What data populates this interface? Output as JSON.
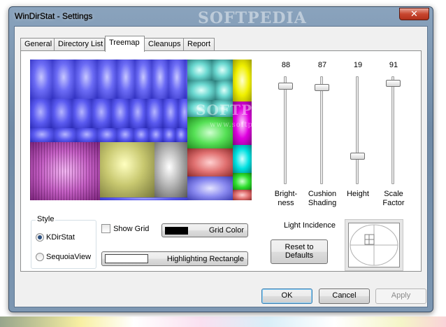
{
  "window": {
    "title": "WinDirStat - Settings",
    "close_glyph": "✕"
  },
  "watermarks": {
    "title": "SOFTPEDIA",
    "center": "SOFTPEDIA",
    "url": "www.softpedia.com"
  },
  "tabs": [
    {
      "label": "General",
      "active": false
    },
    {
      "label": "Directory List",
      "active": false
    },
    {
      "label": "Treemap",
      "active": true
    },
    {
      "label": "Cleanups",
      "active": false
    },
    {
      "label": "Report",
      "active": false
    }
  ],
  "sliders": [
    {
      "value": "88",
      "label_line1": "Bright-",
      "label_line2": "ness",
      "level_percent": 88
    },
    {
      "value": "87",
      "label_line1": "Cushion",
      "label_line2": "Shading",
      "level_percent": 87
    },
    {
      "value": "19",
      "label_line1": "Height",
      "label_line2": "",
      "level_percent": 19
    },
    {
      "value": "91",
      "label_line1": "Scale",
      "label_line2": "Factor",
      "level_percent": 91
    }
  ],
  "style_group": {
    "title": "Style",
    "options": [
      {
        "label": "KDirStat",
        "checked": true
      },
      {
        "label": "SequoiaView",
        "checked": false
      }
    ]
  },
  "show_grid": {
    "label": "Show Grid",
    "checked": false
  },
  "grid_color_button": {
    "label": "Grid Color",
    "swatch_color": "#000000"
  },
  "highlight_button": {
    "label": "Highlighting Rectangle",
    "swatch_color": "#ffffff"
  },
  "light_incidence": {
    "label": "Light Incidence"
  },
  "reset_button": {
    "line1": "Reset to",
    "line2": "Defaults"
  },
  "dialog_buttons": {
    "ok": "OK",
    "cancel": "Cancel",
    "apply": "Apply"
  }
}
